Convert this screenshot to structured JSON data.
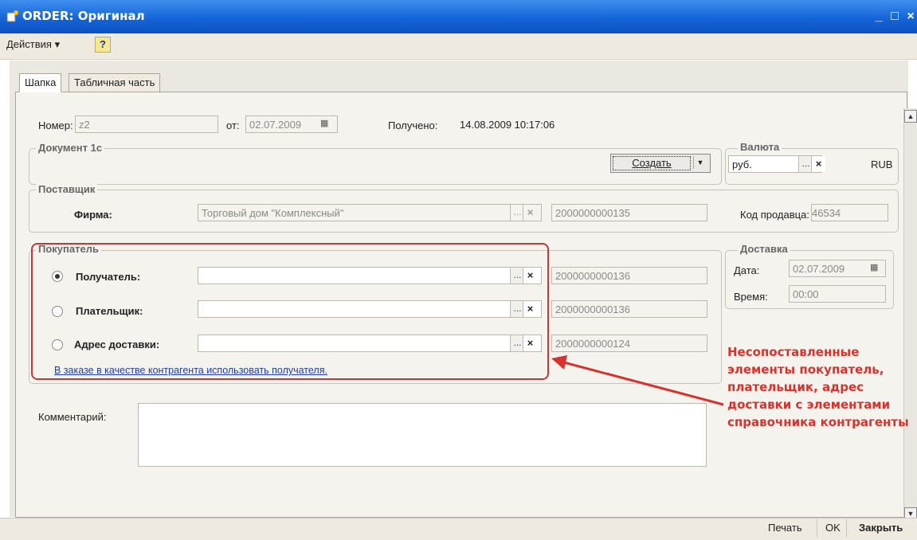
{
  "window": {
    "title": "ORDER: Оригинал",
    "min": "_",
    "max": "□",
    "close": "×"
  },
  "menu": {
    "actions": "Действия ▾",
    "help": "?"
  },
  "tabs": [
    "Шапка",
    "Табличная часть"
  ],
  "header": {
    "nomer_label": "Номер:",
    "nomer_value": "z2",
    "ot_label": "от:",
    "ot_value": "02.07.2009",
    "received_label": "Получено:",
    "received_value": "14.08.2009 10:17:06"
  },
  "document_group": {
    "title": "Документ 1с",
    "create_button": "Создать"
  },
  "currency_group": {
    "title": "Валюта",
    "value": "руб.",
    "code": "RUB"
  },
  "supplier_group": {
    "title": "Поставщик",
    "firm_label": "Фирма:",
    "firm_value": "Торговый дом \"Комплексный\"",
    "firm_code": "2000000000135",
    "seller_code_label": "Код продавца:",
    "seller_code_value": "46534"
  },
  "buyer_group": {
    "title": "Покупатель",
    "rows": [
      {
        "label": "Получатель:",
        "code": "2000000000136",
        "selected": true
      },
      {
        "label": "Плательщик:",
        "code": "2000000000136",
        "selected": false
      },
      {
        "label": "Адрес доставки:",
        "code": "2000000000124",
        "selected": false
      }
    ],
    "link": "В заказе в качестве контрагента использовать получателя."
  },
  "delivery_group": {
    "title": "Доставка",
    "date_label": "Дата:",
    "date_value": "02.07.2009",
    "time_label": "Время:",
    "time_value": "00:00"
  },
  "comment_label": "Комментарий:",
  "annotation": "Несопоставленные элементы покупатель, плательщик, адрес доставки с элементами справочника контрагенты",
  "footer": {
    "print": "Печать",
    "ok": "OK",
    "close": "Закрыть"
  },
  "colors": {
    "titlebar": "#1565d8",
    "annotation": "#d8322d",
    "link": "#1f3fa6"
  }
}
